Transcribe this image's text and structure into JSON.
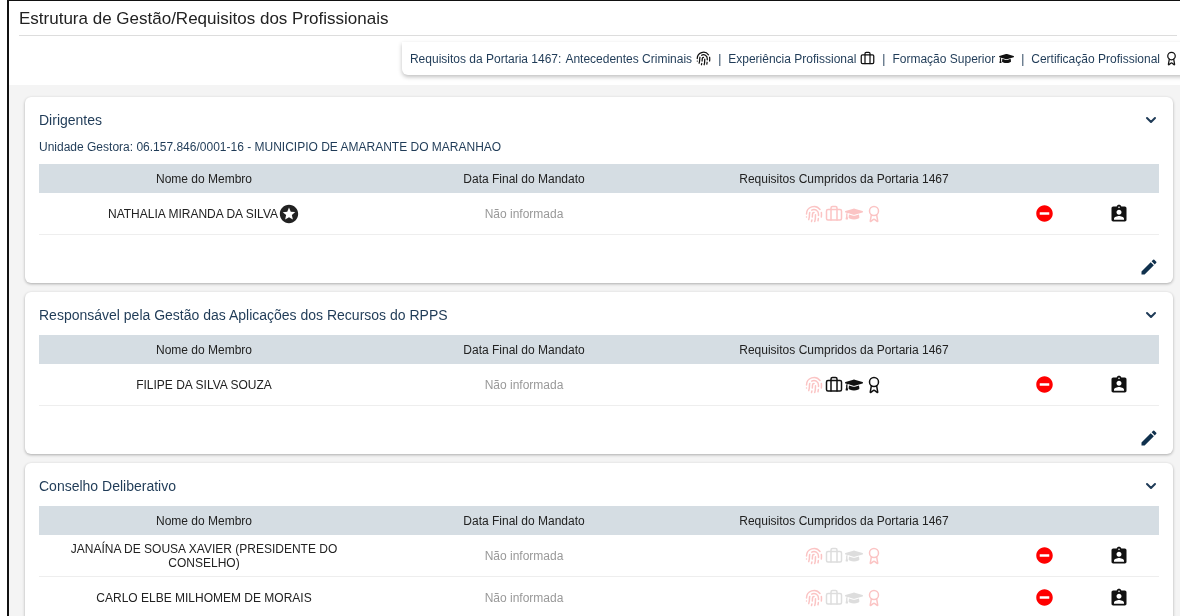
{
  "page_title": "Estrutura de Gestão/Requisitos dos Profissionais",
  "legend": {
    "label": "Requisitos da Portaria 1467:",
    "items": [
      {
        "kind": "criminal",
        "label": "Antecedentes Criminais"
      },
      {
        "kind": "experience",
        "label": "Experiência Profissional"
      },
      {
        "kind": "education",
        "label": "Formação Superior"
      },
      {
        "kind": "certification",
        "label": "Certificação Profissional"
      }
    ],
    "separator": "|"
  },
  "sections": [
    {
      "title": "Dirigentes",
      "expanded": true,
      "unit": "Unidade Gestora: 06.157.846/0001-16 - MUNICIPIO DE AMARANTE DO MARANHAO",
      "columns": [
        "Nome do Membro",
        "Data Final do Mandato",
        "Requisitos Cumpridos da Portaria 1467"
      ],
      "rows": [
        {
          "name": "NATHALIA MIRANDA DA SILVA",
          "leader": true,
          "date": "Não informada",
          "requirements": [
            {
              "kind": "criminal",
              "met": false,
              "applicable": true
            },
            {
              "kind": "experience",
              "met": false,
              "applicable": true
            },
            {
              "kind": "education",
              "met": false,
              "applicable": true
            },
            {
              "kind": "certification",
              "met": false,
              "applicable": true
            }
          ]
        }
      ],
      "editable": true
    },
    {
      "title": "Responsável pela Gestão das Aplicações dos Recursos do RPPS",
      "expanded": true,
      "columns": [
        "Nome do Membro",
        "Data Final do Mandato",
        "Requisitos Cumpridos da Portaria 1467"
      ],
      "rows": [
        {
          "name": "FILIPE DA SILVA SOUZA",
          "leader": false,
          "date": "Não informada",
          "requirements": [
            {
              "kind": "criminal",
              "met": false,
              "applicable": true
            },
            {
              "kind": "experience",
              "met": true,
              "applicable": true
            },
            {
              "kind": "education",
              "met": true,
              "applicable": true
            },
            {
              "kind": "certification",
              "met": true,
              "applicable": true
            }
          ]
        }
      ],
      "editable": true
    },
    {
      "title": "Conselho Deliberativo",
      "expanded": true,
      "columns": [
        "Nome do Membro",
        "Data Final do Mandato",
        "Requisitos Cumpridos da Portaria 1467"
      ],
      "rows": [
        {
          "name": "JANAÍNA DE SOUSA XAVIER (PRESIDENTE DO CONSELHO)",
          "leader": false,
          "date": "Não informada",
          "requirements": [
            {
              "kind": "criminal",
              "met": false,
              "applicable": true
            },
            {
              "kind": "experience",
              "applicable": false
            },
            {
              "kind": "education",
              "applicable": false
            },
            {
              "kind": "certification",
              "met": false,
              "applicable": true
            }
          ]
        },
        {
          "name": "CARLO ELBE MILHOMEM DE MORAIS",
          "leader": false,
          "date": "Não informada",
          "requirements": [
            {
              "kind": "criminal",
              "met": false,
              "applicable": true
            },
            {
              "kind": "experience",
              "applicable": false
            },
            {
              "kind": "education",
              "applicable": false
            },
            {
              "kind": "certification",
              "met": false,
              "applicable": true
            }
          ]
        }
      ]
    }
  ]
}
